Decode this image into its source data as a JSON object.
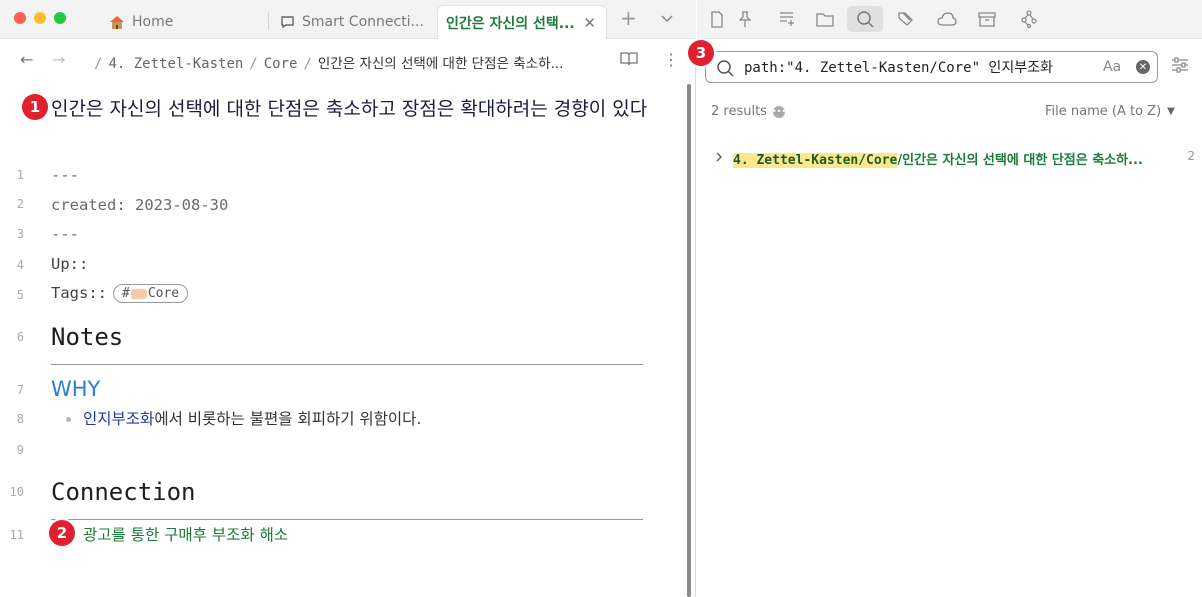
{
  "tabs": [
    {
      "label": "Home",
      "icon": "home-icon"
    },
    {
      "label": "Smart Connecti...",
      "icon": "chat-icon"
    },
    {
      "label": "인간은 자신의 선택...",
      "icon": ""
    }
  ],
  "breadcrumb": {
    "parts": [
      "4. Zettel-Kasten",
      "Core"
    ],
    "current": "인간은 자신의 선택에 대한 단점은 축소하..."
  },
  "note": {
    "title": "인간은 자신의 선택에 대한 단점은 축소하고 장점은 확대하려는 경향이 있다",
    "line_numbers": [
      "1",
      "2",
      "3",
      "4",
      "5",
      "6",
      "7",
      "8",
      "9",
      "10",
      "11"
    ],
    "frontmatter_open": "---",
    "created": "created: 2023-08-30",
    "frontmatter_close": "---",
    "up": "Up::",
    "tags_label": "Tags::",
    "tag_prefix": "#",
    "tag_value": "Core",
    "heading_notes": "Notes",
    "heading_why": "WHY",
    "bullet_link": "인지부조화",
    "bullet_rest": "에서 비롯하는 불편을 회피하기 위함이다.",
    "heading_connection": "Connection",
    "connection_link": "광고를 통한 구매후 부조화 해소"
  },
  "badges": {
    "one": "1",
    "two": "2",
    "three": "3"
  },
  "search": {
    "query": "path:\"4. Zettel-Kasten/Core\" 인지부조화",
    "match_case_label": "Aa",
    "results_count": "2 results",
    "sort_label": "File name (A to Z)",
    "results": [
      {
        "path_highlight": "4. Zettel-Kasten/Core",
        "path_rest": "/인간은 자신의 선택에 대한 단점은 축소하...",
        "count": "2"
      }
    ]
  },
  "colors": {
    "accent_green": "#1c7a3a",
    "highlight": "#fbe88b",
    "badge_red": "#e0202e",
    "heading_blue": "#2a7ed8"
  }
}
